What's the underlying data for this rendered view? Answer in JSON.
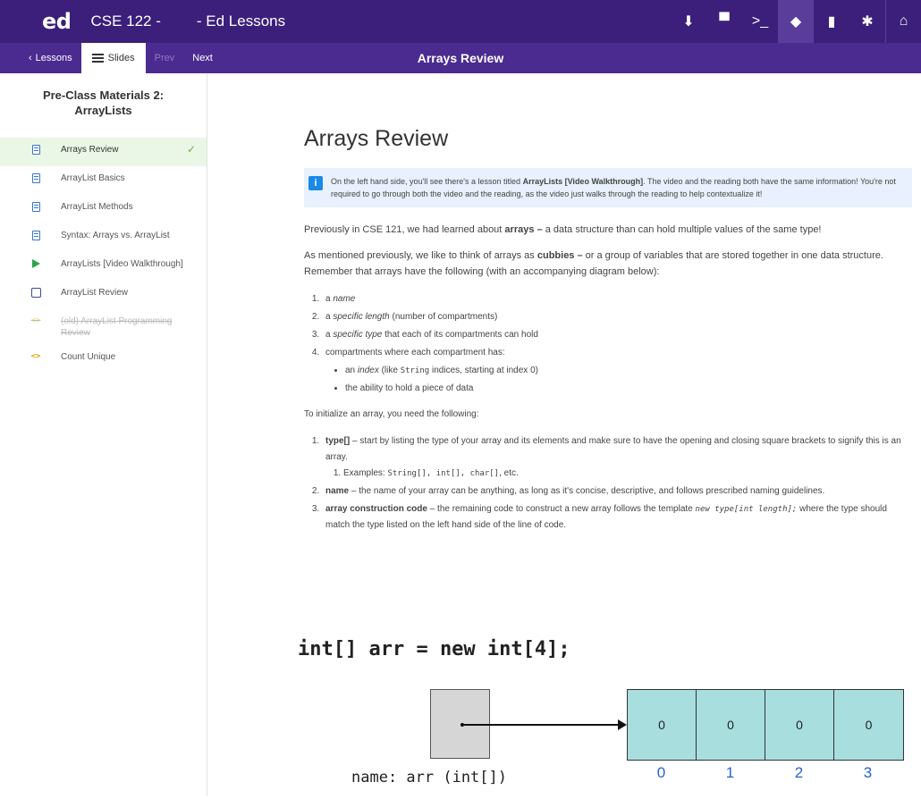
{
  "topbar": {
    "logo": "ed",
    "course": "CSE 122 -",
    "app_title": "- Ed Lessons",
    "icons": [
      {
        "name": "download-icon",
        "glyph": "⬇"
      },
      {
        "name": "chat-icon",
        "glyph": "▀"
      },
      {
        "name": "terminal-icon",
        "glyph": ">_"
      },
      {
        "name": "lessons-icon",
        "glyph": "◆"
      },
      {
        "name": "analytics-icon",
        "glyph": "▮"
      },
      {
        "name": "gear-icon",
        "glyph": "✱"
      },
      {
        "name": "home-icon",
        "glyph": "⌂"
      }
    ]
  },
  "subbar": {
    "lessons_label": "Lessons",
    "slides_label": "Slides",
    "prev_label": "Prev",
    "next_label": "Next",
    "lesson_heading": "Arrays Review"
  },
  "sidebar": {
    "title": "Pre-Class Materials 2: ArrayLists",
    "items": [
      {
        "label": "Arrays Review",
        "icon": "document-icon",
        "active": true,
        "completed": true
      },
      {
        "label": "ArrayList Basics",
        "icon": "document-icon"
      },
      {
        "label": "ArrayList Methods",
        "icon": "document-icon"
      },
      {
        "label": "Syntax: Arrays vs. ArrayList",
        "icon": "document-icon"
      },
      {
        "label": "ArrayLists [Video Walkthrough]",
        "icon": "play-icon"
      },
      {
        "label": "ArrayList Review",
        "icon": "quiz-icon"
      },
      {
        "label": "(old) ArrayList Programming Review",
        "icon": "code-icon",
        "disabled": true
      },
      {
        "label": "Count Unique",
        "icon": "code-icon"
      }
    ],
    "check_glyph": "✓"
  },
  "content": {
    "title": "Arrays Review",
    "info": {
      "pre": "On the left hand side, you'll see there's a lesson titled ",
      "bold": "ArrayLists [Video Walkthrough]",
      "post": ". The video and the reading both have the same information! You're not required to go through both the video and the reading, as the video just walks through the reading to help contextualize it!"
    },
    "p1": {
      "pre": "Previously in CSE 121, we had learned about ",
      "bold": "arrays –",
      "post": " a data structure than can hold multiple values of the same type!"
    },
    "p2": {
      "pre": "As mentioned previously, we like to think of arrays as ",
      "bold": "cubbies –",
      "post": " or a group of variables that are stored together in one data structure. Remember that arrays have the following (with an accompanying diagram below):"
    },
    "list1": {
      "i1_pre": "a ",
      "i1_em": "name",
      "i2_pre": "a ",
      "i2_em": "specific length",
      "i2_post": " (number of compartments)",
      "i3_pre": "a ",
      "i3_em": "specific type",
      "i3_post": " that each of its compartments can hold",
      "i4": "compartments where each compartment has:",
      "s1_pre": "an ",
      "s1_em": "index",
      "s1_mid": " (like ",
      "s1_code": "String",
      "s1_post": " indices, starting at index 0)",
      "s2": "the ability to hold a piece of data"
    },
    "p3": "To initialize an array, you need the following:",
    "list2": {
      "i1_bold": "type[]",
      "i1_text": " – start by listing the type of your array and its elements and make sure to have the opening and closing square brackets to signify this is an array.",
      "i1_sub_pre": "Examples: ",
      "i1_sub_code": "String[], int[], char[]",
      "i1_sub_post": ", etc.",
      "i2_bold": "name",
      "i2_text": " – the name of your array can be anything, as long as it's concise, descriptive, and follows prescribed naming guidelines.",
      "i3_bold": "array construction code",
      "i3_text": " – the remaining code to construct a new array follows the template ",
      "i3_code": "new type[int length];",
      "i3_post": " where the type should match the type listed on the left hand side of the line of code."
    }
  },
  "diagram": {
    "code": "int[] arr = new int[4];",
    "cells": [
      "0",
      "0",
      "0",
      "0"
    ],
    "indices": [
      "0",
      "1",
      "2",
      "3"
    ],
    "name_label": "name: arr (int[])"
  },
  "colors": {
    "topbar": "#3b1f7a",
    "subbar": "#4b2b8f",
    "active_item": "#eaf7e6",
    "info_bg": "#e8f1fd",
    "cell_fill": "#a8dede",
    "index_color": "#2862c6"
  }
}
